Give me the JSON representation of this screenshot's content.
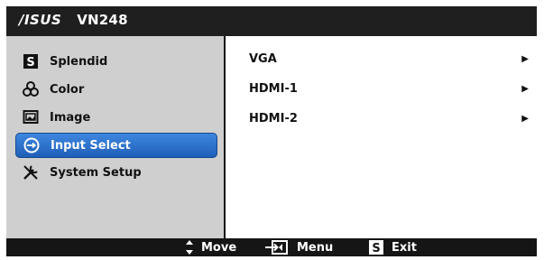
{
  "header": {
    "brand": "/ISUS",
    "model": "VN248"
  },
  "menu": [
    {
      "label": "Splendid",
      "icon": "splendid-icon",
      "selected": false
    },
    {
      "label": "Color",
      "icon": "color-icon",
      "selected": false
    },
    {
      "label": "Image",
      "icon": "image-icon",
      "selected": false
    },
    {
      "label": "Input Select",
      "icon": "input-select-icon",
      "selected": true
    },
    {
      "label": "System Setup",
      "icon": "system-setup-icon",
      "selected": false
    }
  ],
  "submenu": [
    {
      "label": "VGA",
      "icon": "arrow-right-icon"
    },
    {
      "label": "HDMI-1",
      "icon": "arrow-right-icon"
    },
    {
      "label": "HDMI-2",
      "icon": "arrow-right-icon"
    }
  ],
  "footer": {
    "move_label": "Move",
    "menu_label": "Menu",
    "exit_label": "Exit"
  },
  "colors": {
    "selected": "#2f73d0",
    "panel": "#cfcfcf",
    "bar": "#1f1f1f"
  }
}
